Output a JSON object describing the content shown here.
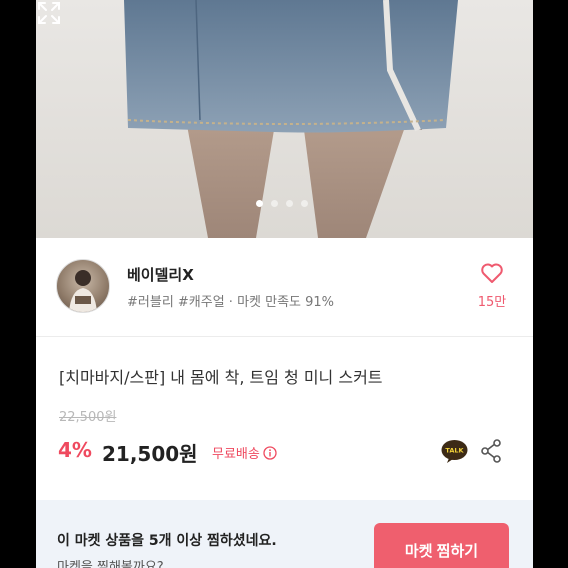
{
  "product_images": {
    "dot_count": 4,
    "active_index": 0,
    "expand_icon": "expand-icon"
  },
  "seller": {
    "name": "베이델리X",
    "tags": "#러블리 #캐주얼 · 마켓 만족도 91%",
    "like_count": "15만",
    "heart_icon": "heart-outline-icon",
    "accent": "#ef5a6f"
  },
  "product": {
    "title": "[치마바지/스판] 내 몸에 착, 트임 청 미니 스커트",
    "original_price": "22,500원",
    "discount": "4%",
    "price": "21,500원",
    "shipping": "무료배송",
    "shipping_icon": "info-icon",
    "talk_label": "TALK",
    "share_icon": "share-icon"
  },
  "banner": {
    "message": "이 마켓 상품을 5개 이상 찜하셨네요.",
    "sub_message": "마켓을 찜해볼까요?",
    "button_label": "마켓 찜하기",
    "button_color": "#ef5f6e"
  }
}
